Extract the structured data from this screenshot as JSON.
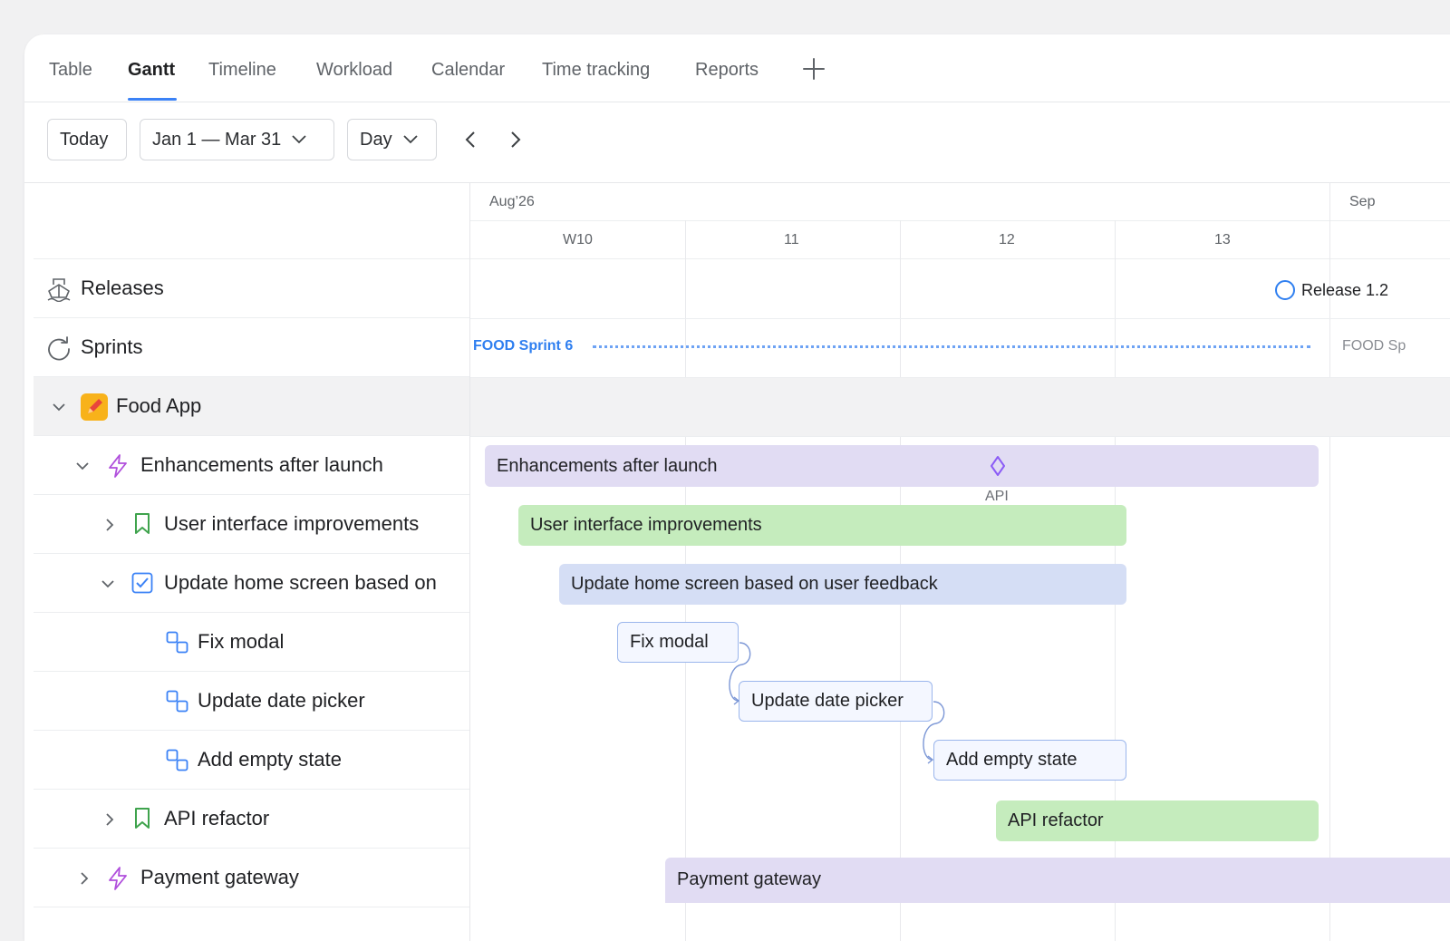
{
  "tabs": [
    {
      "label": "Table",
      "active": false
    },
    {
      "label": "Gantt",
      "active": true
    },
    {
      "label": "Timeline",
      "active": false
    },
    {
      "label": "Workload",
      "active": false
    },
    {
      "label": "Calendar",
      "active": false
    },
    {
      "label": "Time tracking",
      "active": false
    },
    {
      "label": "Reports",
      "active": false
    }
  ],
  "toolbar": {
    "today_label": "Today",
    "date_range": "Jan 1 — Mar 31",
    "scale": "Day"
  },
  "timeline": {
    "months": [
      "Aug’26",
      "Sep"
    ],
    "weeks": [
      "W10",
      "11",
      "12",
      "13"
    ]
  },
  "rows": {
    "releases": "Releases",
    "sprints": "Sprints",
    "project": "Food App",
    "epic": "Enhancements after launch",
    "story1": "User interface improvements",
    "task": "Update home screen based on",
    "sub1": "Fix modal",
    "sub2": "Update date picker",
    "sub3": "Add empty state",
    "story2": "API refactor",
    "epic2": "Payment gateway"
  },
  "bars": {
    "release": "Release 1.2",
    "sprint": "FOOD Sprint 6",
    "sprint_next": "FOOD Sp",
    "epic": "Enhancements after launch",
    "milestone": "API",
    "story1": "User interface improvements",
    "task": "Update home screen based on user feedback",
    "sub1": "Fix modal",
    "sub2": "Update date picker",
    "sub3": "Add empty state",
    "story2": "API refactor",
    "epic2": "Payment gateway"
  },
  "colors": {
    "accent": "#3b82f6",
    "epic": "#e1dcf3",
    "story": "#c5ecbd",
    "task": "#d5def5",
    "subtask_border": "#9bb6ec",
    "epic_icon": "#b04fdc",
    "story_icon": "#3fa34d",
    "task_icon": "#3b82f6"
  },
  "icons": {
    "releases": "ship-icon",
    "sprints": "refresh-icon",
    "project": "project-pencil-icon",
    "epic": "lightning-icon",
    "story": "bookmark-icon",
    "task": "checkbox-icon",
    "subtask": "subtask-icon"
  }
}
